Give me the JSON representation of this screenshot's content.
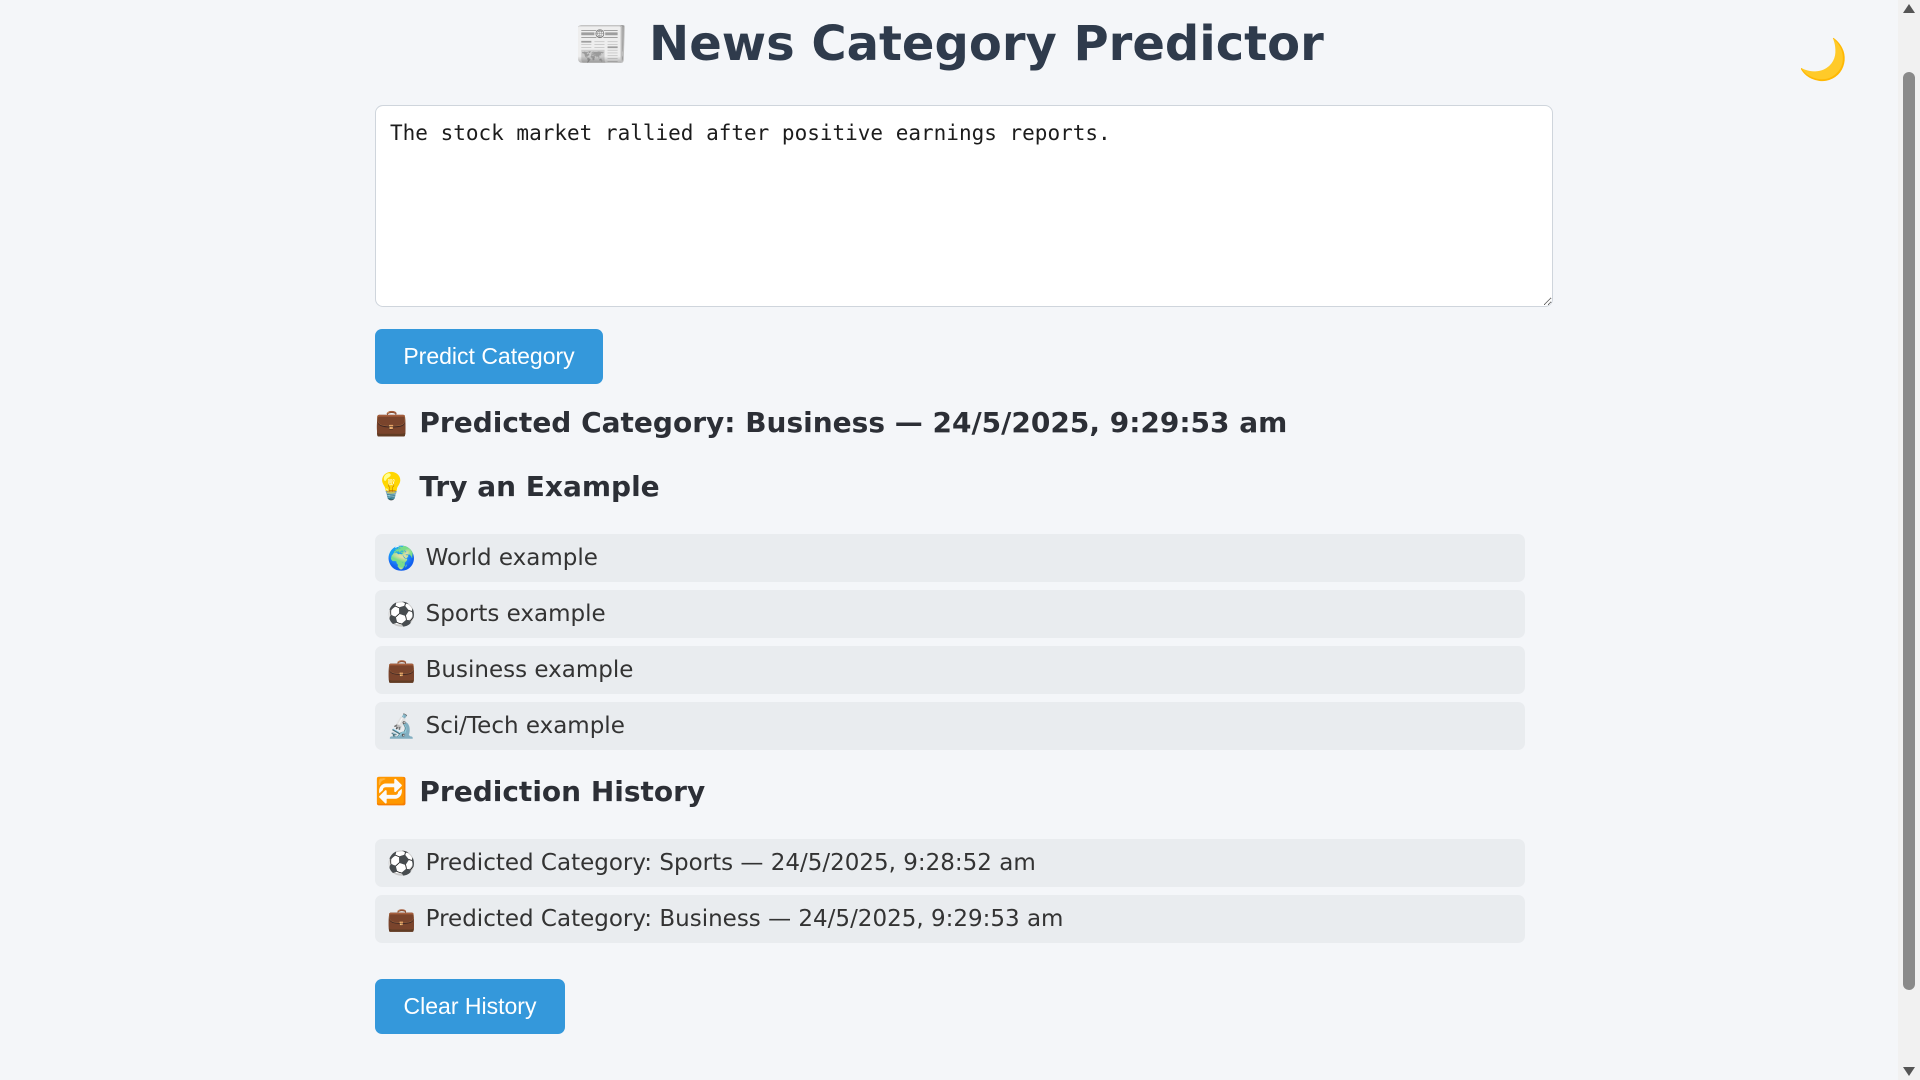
{
  "header": {
    "icon": "newspaper-icon",
    "icon_glyph": "📰",
    "title": "News Category Predictor",
    "theme_toggle_glyph": "🌙",
    "theme_toggle_icon": "moon-icon"
  },
  "input": {
    "value": "The stock market rallied after positive earnings reports."
  },
  "buttons": {
    "predict_label": "Predict Category",
    "clear_label": "Clear History"
  },
  "result": {
    "icon": "briefcase-icon",
    "icon_glyph": "💼",
    "text": "Predicted Category: Business — 24/5/2025, 9:29:53 am"
  },
  "examples": {
    "heading_icon": "lightbulb-icon",
    "heading_glyph": "💡",
    "heading": "Try an Example",
    "items": [
      {
        "icon": "globe-icon",
        "glyph": "🌍",
        "label": "World example"
      },
      {
        "icon": "soccer-ball-icon",
        "glyph": "⚽",
        "label": "Sports example"
      },
      {
        "icon": "briefcase-icon",
        "glyph": "💼",
        "label": "Business example"
      },
      {
        "icon": "microscope-icon",
        "glyph": "🔬",
        "label": "Sci/Tech example"
      }
    ]
  },
  "history": {
    "heading_icon": "repeat-icon",
    "heading_glyph": "🔁",
    "heading": "Prediction History",
    "items": [
      {
        "icon": "soccer-ball-icon",
        "glyph": "⚽",
        "text": "Predicted Category: Sports — 24/5/2025, 9:28:52 am"
      },
      {
        "icon": "briefcase-icon",
        "glyph": "💼",
        "text": "Predicted Category: Business — 24/5/2025, 9:29:53 am"
      }
    ]
  },
  "colors": {
    "accent": "#3498db",
    "background": "#f4f6f9",
    "item_background": "#e9ecef"
  }
}
